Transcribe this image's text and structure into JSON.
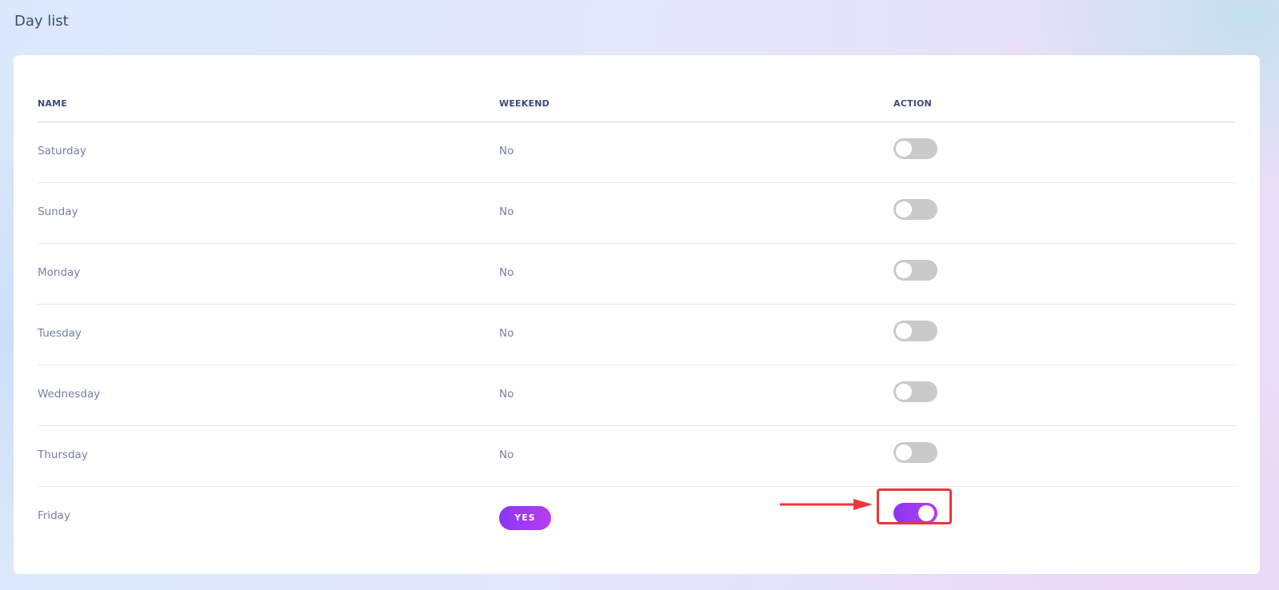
{
  "page": {
    "title": "Day list"
  },
  "table": {
    "headers": {
      "name": "NAME",
      "weekend": "WEEKEND",
      "action": "ACTION"
    },
    "rows": [
      {
        "name": "Saturday",
        "weekend": "No",
        "action_on": false
      },
      {
        "name": "Sunday",
        "weekend": "No",
        "action_on": false
      },
      {
        "name": "Monday",
        "weekend": "No",
        "action_on": false
      },
      {
        "name": "Tuesday",
        "weekend": "No",
        "action_on": false
      },
      {
        "name": "Wednesday",
        "weekend": "No",
        "action_on": false
      },
      {
        "name": "Thursday",
        "weekend": "No",
        "action_on": false
      },
      {
        "name": "Friday",
        "weekend": "YES",
        "action_on": true
      }
    ]
  },
  "colors": {
    "accent_start": "#8a36f3",
    "accent_end": "#b73df0",
    "toggle_off": "#cacaca",
    "annotation": "#e8363d"
  }
}
